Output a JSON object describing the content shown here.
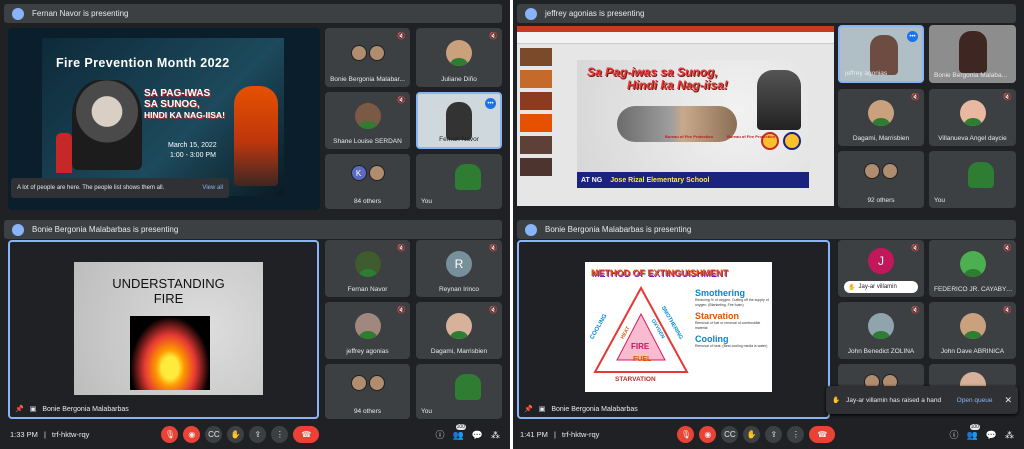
{
  "q1": {
    "header": "Fernan Navor is presenting",
    "slide": {
      "title": "Fire Prevention Month 2022",
      "line1": "SA PAG-IWAS",
      "line2": "SA SUNOG,",
      "line3": "HINDI KA NAG-IISA!",
      "date": "March 15, 2022",
      "time": "1:00 - 3:00 PM"
    },
    "toast": {
      "text": "A lot of people are here. The people list shows them all.",
      "action": "View all"
    },
    "tiles": [
      "Bonie Bergonia Malabar...",
      "Juliane Diño",
      "Shane Louise SERDAN",
      "Fernan Navor",
      "84 others",
      "You"
    ],
    "others_letter": "K",
    "bar": {
      "time": "1:33 PM",
      "code": "trf-hktw-rqy",
      "people_count": "100"
    }
  },
  "q2": {
    "header": "jeffrey agonias is presenting",
    "slide": {
      "line1": "Sa Pag-iwas sa Sunog,",
      "line2": "Hindi ka Nag-iisa!",
      "school": "Jose Rizal Elementary School",
      "atng": "AT NG",
      "badge1": "Bureau of Fire Protection",
      "badge2": "Bureau of Fire Protection"
    },
    "tiles": [
      "jeffrey agonias",
      "Bonie Bergonia Malaba...",
      "Dagami, Marrisbien",
      "Villanueva Angel daycie",
      "92 others",
      "You"
    ]
  },
  "q3": {
    "header": "Bonie Bergonia Malabarbas is presenting",
    "slide": {
      "line1": "UNDERSTANDING",
      "line2": "FIRE"
    },
    "stage_name": "Bonie Bergonia Malabarbas",
    "tiles": [
      "Fernan Navor",
      "Reynan Irinco",
      "jeffrey agonias",
      "Dagami, Marrisbien",
      "94 others",
      "You"
    ],
    "reynan_letter": "R"
  },
  "q4": {
    "header": "Bonie Bergonia Malabarbas is presenting",
    "slide": {
      "title": "METHOD OF EXTINGUISHMENT",
      "smothering": "Smothering",
      "smothering_desc": "Reducing % of oxygen. Cutting off the supply of oxygen. (Blanketing, Fire foam)",
      "starvation": "Starvation",
      "starvation_desc": "Removal of fuel or removal of combustible material",
      "cooling": "Cooling",
      "cooling_desc": "Removal of heat. (Best cooling media is water)",
      "fire": "FIRE",
      "fuel": "FUEL",
      "starv_base": "STARVATION",
      "cool_side": "COOLING",
      "smoth_side": "SMOTHERING",
      "heat": "HEAT",
      "oxygen": "OXYGEN"
    },
    "stage_name": "Bonie Bergonia Malabarbas",
    "tiles": [
      "Jay-ar villamin",
      "FEDERICO JR. CAYABYAB",
      "John Benedict ZOLINA",
      "John Dave ABRINICA"
    ],
    "jay_letter": "J",
    "toast": {
      "text": "Jay-ar villamin has raised a hand",
      "action": "Open queue"
    },
    "bar": {
      "time": "1:41 PM",
      "code": "trf-hktw-rqy",
      "people_count": "100"
    }
  },
  "colors": {
    "bg": "#202124",
    "tile": "#3c4043",
    "accent": "#8ab4f8",
    "red": "#ea4335"
  }
}
